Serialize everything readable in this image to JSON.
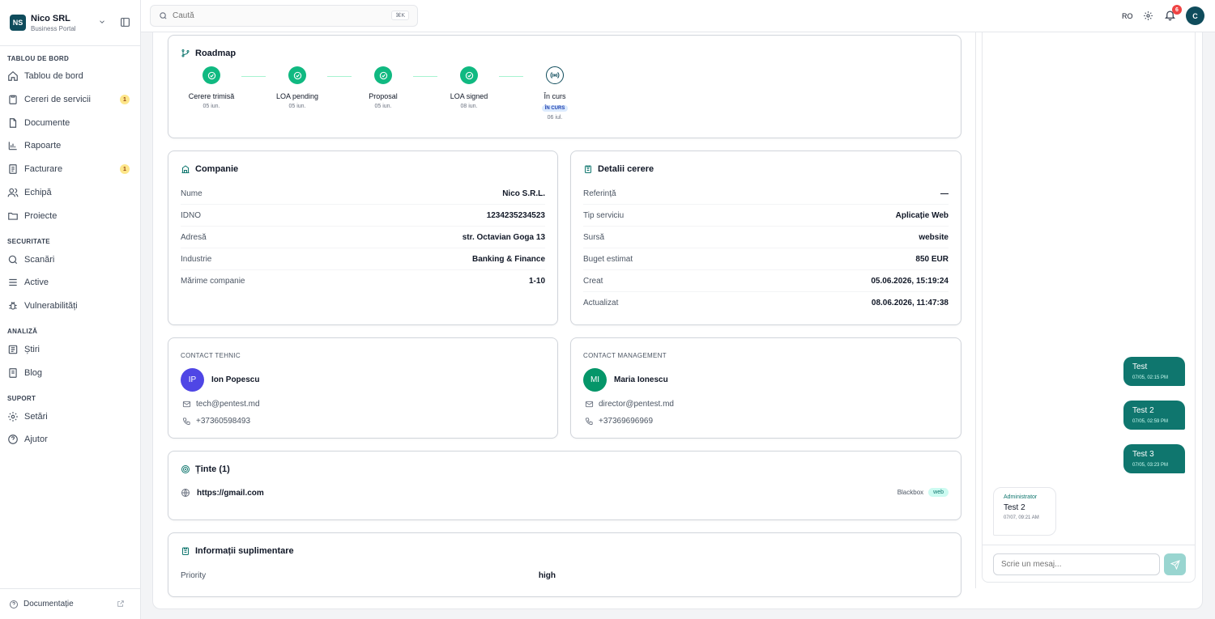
{
  "brand": {
    "logo": "NS",
    "name": "Nico SRL",
    "subtitle": "Business Portal"
  },
  "sidebar": {
    "sections": [
      {
        "title": "TABLOU DE BORD",
        "items": [
          {
            "label": "Tablou de bord",
            "icon": "home-icon"
          },
          {
            "label": "Cereri de servicii",
            "icon": "clipboard-icon",
            "badge": "1"
          },
          {
            "label": "Documente",
            "icon": "document-icon"
          },
          {
            "label": "Rapoarte",
            "icon": "bar-chart-icon"
          },
          {
            "label": "Facturare",
            "icon": "invoice-icon",
            "badge": "1"
          },
          {
            "label": "Echipă",
            "icon": "users-icon"
          },
          {
            "label": "Proiecte",
            "icon": "folder-icon"
          }
        ]
      },
      {
        "title": "SECURITATE",
        "items": [
          {
            "label": "Scanări",
            "icon": "search-icon"
          },
          {
            "label": "Active",
            "icon": "server-icon"
          },
          {
            "label": "Vulnerabilități",
            "icon": "bug-icon"
          }
        ]
      },
      {
        "title": "ANALIZĂ",
        "items": [
          {
            "label": "Știri",
            "icon": "newspaper-icon"
          },
          {
            "label": "Blog",
            "icon": "blog-icon"
          }
        ]
      },
      {
        "title": "SUPORT",
        "items": [
          {
            "label": "Setări",
            "icon": "gear-icon"
          },
          {
            "label": "Ajutor",
            "icon": "help-icon"
          }
        ]
      }
    ],
    "footer": {
      "label": "Documentație"
    }
  },
  "topbar": {
    "search_placeholder": "Caută",
    "shortcut": "⌘K",
    "language": "RO",
    "notifications": "6",
    "user_initial": "C"
  },
  "roadmap": {
    "title": "Roadmap",
    "steps": [
      {
        "label": "Cerere trimisă",
        "date": "05 iun.",
        "status": "done"
      },
      {
        "label": "LOA pending",
        "date": "05 iun.",
        "status": "done"
      },
      {
        "label": "Proposal",
        "date": "05 iun.",
        "status": "done"
      },
      {
        "label": "LOA signed",
        "date": "08 iun.",
        "status": "done"
      },
      {
        "label": "În curs",
        "pill": "ÎN CURS",
        "date": "06 iul.",
        "status": "current"
      }
    ]
  },
  "company": {
    "title": "Companie",
    "rows": [
      {
        "key": "Nume",
        "value": "Nico S.R.L."
      },
      {
        "key": "IDNO",
        "value": "1234235234523"
      },
      {
        "key": "Adresă",
        "value": "str. Octavian Goga 13"
      },
      {
        "key": "Industrie",
        "value": "Banking & Finance"
      },
      {
        "key": "Mărime companie",
        "value": "1-10"
      }
    ]
  },
  "request_details": {
    "title": "Detalii cerere",
    "rows": [
      {
        "key": "Referință",
        "value": "—"
      },
      {
        "key": "Tip serviciu",
        "value": "Aplicație Web"
      },
      {
        "key": "Sursă",
        "value": "website"
      },
      {
        "key": "Buget estimat",
        "value": "850 EUR"
      },
      {
        "key": "Creat",
        "value": "05.06.2026, 15:19:24"
      },
      {
        "key": "Actualizat",
        "value": "08.06.2026, 11:47:38"
      }
    ]
  },
  "contacts": {
    "technical": {
      "heading": "CONTACT TEHNIC",
      "initials": "IP",
      "name": "Ion Popescu",
      "email": "tech@pentest.md",
      "phone": "+37360598493",
      "color": "#4f46e5"
    },
    "management": {
      "heading": "CONTACT MANAGEMENT",
      "initials": "MI",
      "name": "Maria Ionescu",
      "email": "director@pentest.md",
      "phone": "+37369696969",
      "color": "#059669"
    }
  },
  "targets": {
    "title": "Ținte (1)",
    "items": [
      {
        "url": "https://gmail.com",
        "type": "Blackbox",
        "tag": "web"
      }
    ]
  },
  "additional": {
    "title": "Informații suplimentare",
    "rows": [
      {
        "key": "Priority",
        "value": "high"
      }
    ]
  },
  "chat": {
    "messages_out": [
      {
        "text": "Test",
        "time": "07/05, 02:15 PM"
      },
      {
        "text": "Test 2",
        "time": "07/05, 02:59 PM"
      },
      {
        "text": "Test 3",
        "time": "07/05, 03:23 PM"
      }
    ],
    "message_in": {
      "author": "Administrator",
      "text": "Test 2",
      "time": "07/07, 09:21 AM"
    },
    "input_placeholder": "Scrie un mesaj..."
  },
  "colors": {
    "accent": "#0f766e",
    "brand": "#0f4c5c",
    "success": "#10b981"
  }
}
